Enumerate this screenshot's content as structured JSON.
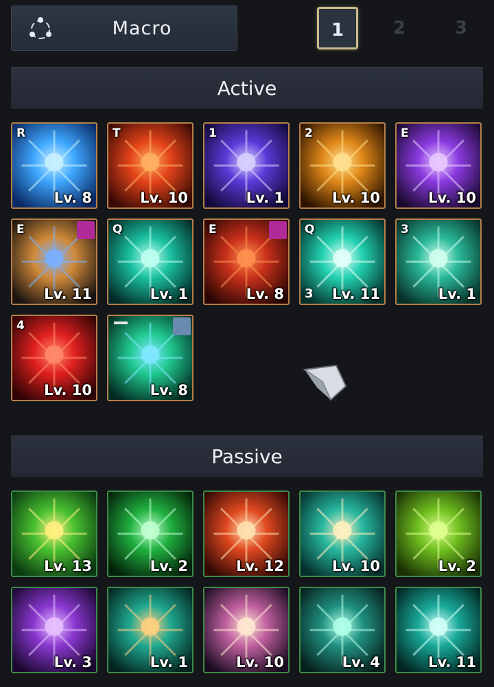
{
  "header": {
    "macro_label": "Macro",
    "pages": [
      "1",
      "2",
      "3"
    ],
    "active_page": "1"
  },
  "sections": {
    "active_title": "Active",
    "passive_title": "Passive"
  },
  "active_skills": [
    {
      "key": "R",
      "level": "Lv. 8",
      "icon": "blue-comet-icon",
      "colors": [
        "#0a2a66",
        "#3fa8ff",
        "#c8f0ff"
      ]
    },
    {
      "key": "T",
      "level": "Lv. 10",
      "icon": "fire-dragon-icon",
      "colors": [
        "#3a0a04",
        "#e4431a",
        "#ffb060"
      ]
    },
    {
      "key": "1",
      "level": "Lv. 1",
      "icon": "lightning-orb-icon",
      "colors": [
        "#140a3a",
        "#5a3ad8",
        "#d8d0ff"
      ]
    },
    {
      "key": "2",
      "level": "Lv. 10",
      "icon": "golden-rune-icon",
      "colors": [
        "#2e1400",
        "#e08818",
        "#ffe090"
      ]
    },
    {
      "key": "E",
      "level": "Lv. 10",
      "icon": "shadow-lightning-icon",
      "colors": [
        "#1a0a30",
        "#8a3ae0",
        "#e8c8ff"
      ]
    },
    {
      "key": "E",
      "level": "Lv. 11",
      "icon": "warrior-blade-icon",
      "colors": [
        "#1c1410",
        "#d08a3a",
        "#7ab0ff"
      ],
      "corner_badge": "#b02a9a"
    },
    {
      "key": "Q",
      "level": "Lv. 1",
      "icon": "teal-burst-icon",
      "colors": [
        "#032a26",
        "#1ac0a0",
        "#c0fff0"
      ]
    },
    {
      "key": "E",
      "level": "Lv. 8",
      "icon": "flame-pillar-icon",
      "colors": [
        "#2a0604",
        "#c8301a",
        "#ff9050"
      ],
      "corner_badge": "#b02a9a"
    },
    {
      "key": "Q",
      "level": "Lv. 11",
      "icon": "teal-star-icon",
      "colors": [
        "#04302a",
        "#22d0b0",
        "#e0fff8"
      ],
      "count": "3"
    },
    {
      "key": "3",
      "level": "Lv. 1",
      "icon": "teal-ring-icon",
      "colors": [
        "#063028",
        "#2ab898",
        "#d0fff0"
      ]
    },
    {
      "key": "4",
      "level": "Lv. 10",
      "icon": "red-aura-warrior-icon",
      "colors": [
        "#300404",
        "#e02020",
        "#ff8a6a"
      ]
    },
    {
      "key": "",
      "level": "Lv. 8",
      "icon": "green-vortex-icon",
      "colors": [
        "#032a20",
        "#20c890",
        "#80e8ff"
      ],
      "bar_badge": true,
      "corner_badge": "#6a8ab0"
    }
  ],
  "passive_skills": [
    {
      "level": "Lv. 13",
      "icon": "golden-sun-icon",
      "colors": [
        "#0a3a10",
        "#48c030",
        "#fff080"
      ]
    },
    {
      "level": "Lv. 2",
      "icon": "green-diamond-icon",
      "colors": [
        "#032008",
        "#20b040",
        "#c0ffd0"
      ]
    },
    {
      "level": "Lv. 12",
      "icon": "fire-rain-icon",
      "colors": [
        "#300804",
        "#e04820",
        "#ffe0b0"
      ]
    },
    {
      "level": "Lv. 10",
      "icon": "crescent-star-icon",
      "colors": [
        "#04302c",
        "#28b8a0",
        "#fff0c0"
      ]
    },
    {
      "level": "Lv. 2",
      "icon": "nature-guardian-icon",
      "colors": [
        "#1a3004",
        "#70c020",
        "#e0ff90"
      ]
    },
    {
      "level": "Lv. 3",
      "icon": "ankh-icon",
      "colors": [
        "#1a0830",
        "#8a38d0",
        "#e8c0ff"
      ]
    },
    {
      "level": "Lv. 1",
      "icon": "praying-priestess-icon",
      "colors": [
        "#03241e",
        "#20a890",
        "#ffd080"
      ]
    },
    {
      "level": "Lv. 10",
      "icon": "light-beam-icon",
      "colors": [
        "#1a0c20",
        "#c060a0",
        "#ffe8d0"
      ]
    },
    {
      "level": "Lv. 4",
      "icon": "armored-knight-icon",
      "colors": [
        "#06201c",
        "#209080",
        "#b0ffe8"
      ]
    },
    {
      "level": "Lv. 11",
      "icon": "holy-light-icon",
      "colors": [
        "#022420",
        "#18a898",
        "#d0fff8"
      ]
    }
  ]
}
